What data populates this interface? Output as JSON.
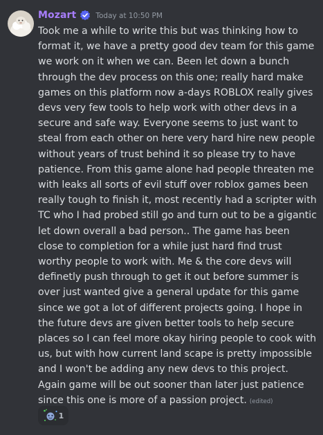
{
  "message": {
    "username": "Mozart",
    "timestamp": "Today at 10:50 PM",
    "body": "Took me a while to write this but was thinking how to format it, we have a pretty good dev team for this game we work on it when we can. Been let down a bunch through the dev process on this one; really hard make games on this platform now a-days ROBLOX really gives devs very few tools to help work with other devs in a secure and safe way. Everyone seems to just want to steal from each other on here very hard hire new people without years of trust behind it so please try to have patience. From this game alone had people threaten  me with leaks all sorts of evil stuff over roblox games been really tough to finish it, most recently had a scripter with TC who I had probed still go and turn out to be a gigantic let down overall a bad person.. The game has been close to completion for a while just hard find trust worthy people to work with. Me & the core devs will definetly push through to get it out before summer is over just wanted give a general update for this game since we got a lot of different projects going. I hope in the future devs are given better tools to help secure places so I can feel more okay hiring people to cook with us, but with how current land scape is pretty impossible and I won't be adding any new devs to this project. Again game will be out sooner than later just patience since this one is more of a passion project.",
    "edited_label": "(edited)",
    "username_color": "#a77dfa",
    "verified_color": "#5865f2",
    "avatar_icon": "sheep-avatar-icon"
  },
  "reaction": {
    "emoji": "party-emoji",
    "count": "1"
  }
}
